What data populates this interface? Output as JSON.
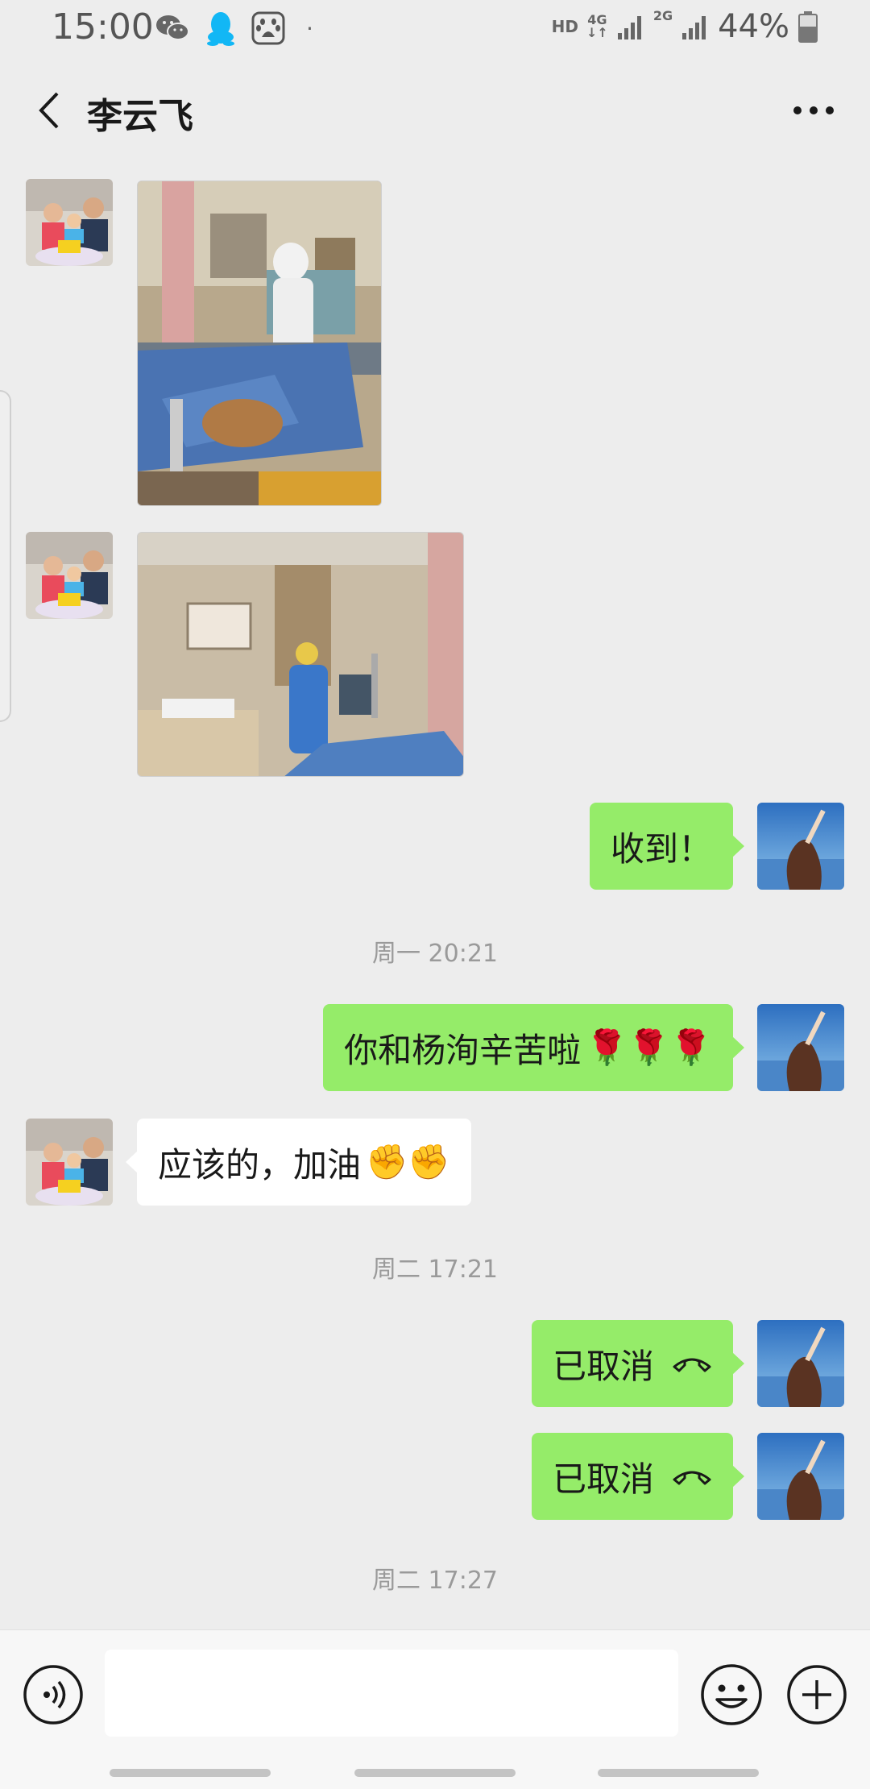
{
  "status_bar": {
    "time": "15:00",
    "network_hd": "HD",
    "network_4g": "4G",
    "network_2g": "2G",
    "battery": "44%",
    "app_icons": [
      "wechat-icon",
      "qq-icon",
      "baidu-paw-icon",
      "dot"
    ]
  },
  "header": {
    "title": "李云飞",
    "back_icon": "chevron-left-icon",
    "more_icon": "more-dots-icon"
  },
  "messages": [
    {
      "type": "image",
      "direction": "in",
      "subject": "hospital-room-photo"
    },
    {
      "type": "image",
      "direction": "in",
      "subject": "icu-room-photo"
    },
    {
      "type": "text",
      "direction": "out",
      "text": "收到！"
    },
    {
      "type": "timestamp",
      "text": "周一 20:21"
    },
    {
      "type": "text",
      "direction": "out",
      "text": "你和杨洵辛苦啦",
      "emoji": "🌹🌹🌹"
    },
    {
      "type": "text",
      "direction": "in",
      "text": "应该的，加油",
      "emoji": "✊✊"
    },
    {
      "type": "timestamp",
      "text": "周二 17:21"
    },
    {
      "type": "call",
      "direction": "out",
      "text": "已取消"
    },
    {
      "type": "call",
      "direction": "out",
      "text": "已取消"
    },
    {
      "type": "timestamp",
      "text": "周二 17:27"
    }
  ],
  "input_bar": {
    "placeholder": "",
    "voice_icon": "voice-icon",
    "emoji_icon": "smiley-icon",
    "plus_icon": "plus-icon"
  },
  "colors": {
    "background": "#ededed",
    "outgoing_bubble": "#95ec69",
    "incoming_bubble": "#ffffff",
    "timestamp_text": "#9a9a9a"
  }
}
